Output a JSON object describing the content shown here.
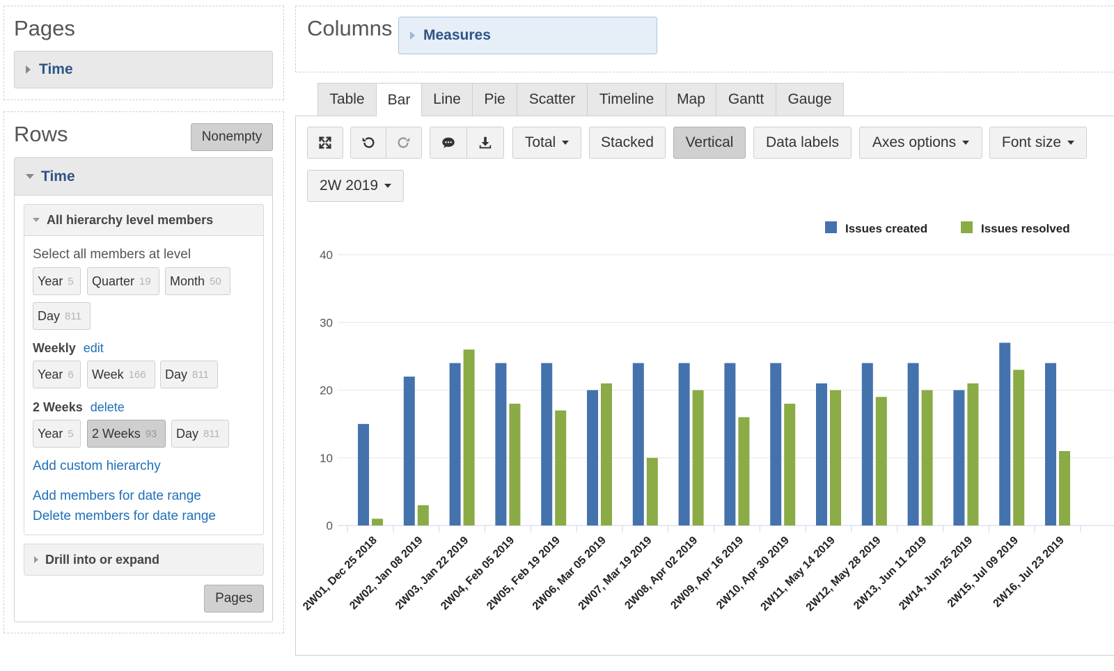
{
  "pages_panel": {
    "title": "Pages",
    "time_label": "Time"
  },
  "columns_panel": {
    "title": "Columns",
    "measures_label": "Measures"
  },
  "rows_panel": {
    "title": "Rows",
    "nonempty_label": "Nonempty",
    "time_label": "Time",
    "hierarchy_header": "All hierarchy level members",
    "select_label": "Select all members at level",
    "default_levels": [
      {
        "name": "Year",
        "count": "5"
      },
      {
        "name": "Quarter",
        "count": "19"
      },
      {
        "name": "Month",
        "count": "50"
      },
      {
        "name": "Day",
        "count": "811"
      }
    ],
    "weekly_label": "Weekly",
    "weekly_action": "edit",
    "weekly_levels": [
      {
        "name": "Year",
        "count": "6"
      },
      {
        "name": "Week",
        "count": "166"
      },
      {
        "name": "Day",
        "count": "811"
      }
    ],
    "two_weeks_label": "2 Weeks",
    "two_weeks_action": "delete",
    "two_weeks_levels": [
      {
        "name": "Year",
        "count": "5"
      },
      {
        "name": "2 Weeks",
        "count": "93"
      },
      {
        "name": "Day",
        "count": "811"
      }
    ],
    "add_custom": "Add custom hierarchy",
    "add_range": "Add members for date range",
    "delete_range": "Delete members for date range",
    "drill_label": "Drill into or expand",
    "pages_button": "Pages"
  },
  "tabs": [
    "Table",
    "Bar",
    "Line",
    "Pie",
    "Scatter",
    "Timeline",
    "Map",
    "Gantt",
    "Gauge"
  ],
  "active_tab": "Bar",
  "toolbar": {
    "total": "Total",
    "stacked": "Stacked",
    "vertical": "Vertical",
    "data_labels": "Data labels",
    "axes_options": "Axes options",
    "font_size": "Font size",
    "period": "2W 2019",
    "icons": [
      "fullscreen-icon",
      "undo-icon",
      "redo-icon",
      "comment-icon",
      "download-icon"
    ]
  },
  "colors": {
    "created": "#4472ad",
    "resolved": "#8aab45",
    "link": "#1f6fb8"
  },
  "chart_data": {
    "type": "bar",
    "categories": [
      "2W01, Dec 25 2018",
      "2W02, Jan 08 2019",
      "2W03, Jan 22 2019",
      "2W04, Feb 05 2019",
      "2W05, Feb 19 2019",
      "2W06, Mar 05 2019",
      "2W07, Mar 19 2019",
      "2W08, Apr 02 2019",
      "2W09, Apr 16 2019",
      "2W10, Apr 30 2019",
      "2W11, May 14 2019",
      "2W12, May 28 2019",
      "2W13, Jun 11 2019",
      "2W14, Jun 25 2019",
      "2W15, Jul 09 2019",
      "2W16, Jul 23 2019"
    ],
    "series": [
      {
        "name": "Issues created",
        "values": [
          15,
          22,
          24,
          24,
          24,
          20,
          24,
          24,
          24,
          24,
          21,
          24,
          24,
          20,
          27,
          24
        ]
      },
      {
        "name": "Issues resolved",
        "values": [
          1,
          3,
          26,
          18,
          17,
          21,
          10,
          20,
          16,
          18,
          20,
          19,
          20,
          21,
          23,
          11
        ]
      }
    ],
    "yticks": [
      0,
      10,
      20,
      30,
      40
    ],
    "ylim": [
      0,
      40
    ],
    "grid": true,
    "legend": "top-right"
  }
}
